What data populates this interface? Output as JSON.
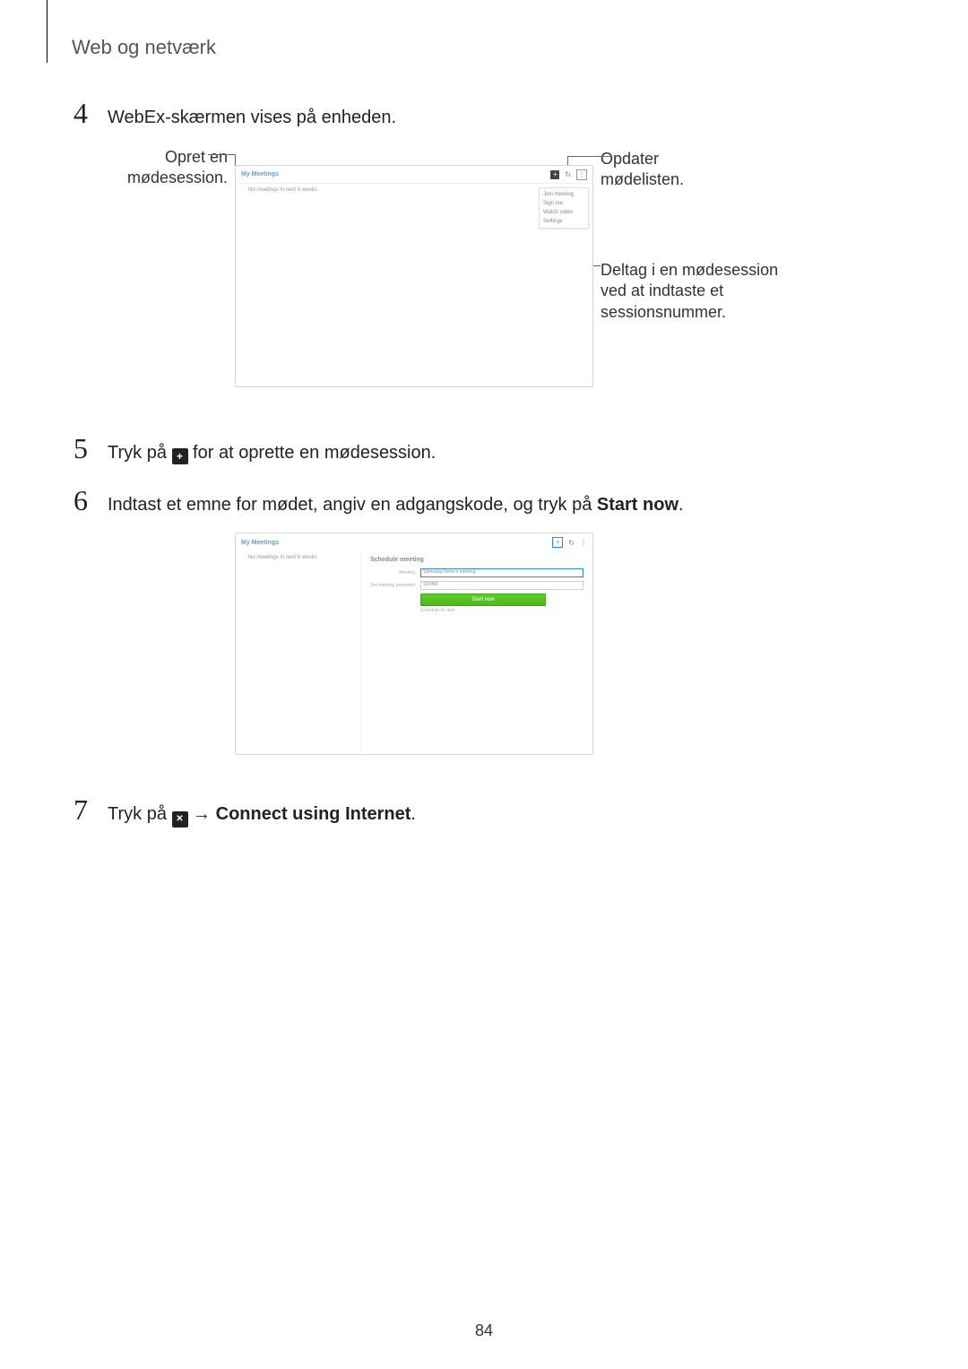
{
  "section_title": "Web og netværk",
  "steps": {
    "s4": {
      "num": "4",
      "text": "WebEx-skærmen vises på enheden."
    },
    "s5": {
      "num": "5",
      "pre": "Tryk på ",
      "post": " for at oprette en mødesession.",
      "icon_symbol": "+",
      "icon_name": "plus"
    },
    "s6": {
      "num": "6",
      "pre": "Indtast et emne for mødet, angiv en adgangskode, og tryk på ",
      "bold": "Start now",
      "post": "."
    },
    "s7": {
      "num": "7",
      "pre": "Tryk på ",
      "arrow": " → ",
      "bold": "Connect using Internet",
      "post": ".",
      "icon_symbol": "✕",
      "icon_name": "signal"
    }
  },
  "annotations": {
    "opret": "Opret en mødesession.",
    "opdater": "Opdater mødelisten.",
    "deltag": "Deltag i en mødesession ved at indtaste et sessionsnummer."
  },
  "shot1": {
    "title": "My Meetings",
    "empty_text": "No meetings in next 6 weeks",
    "dropdown": [
      "Join meeting",
      "Sign me",
      "Watch video",
      "Settings"
    ]
  },
  "shot2": {
    "title": "My Meetings",
    "empty_text": "No meetings in next 6 weeks",
    "panel_heading": "Schedule meeting",
    "meeting_label": "Meeting",
    "meeting_value": "Samsung Demo's meeting",
    "password_label": "Set meeting password",
    "password_value": "123456",
    "start_button": "Start now",
    "schedule_later": "Schedule for later"
  },
  "page_number": "84"
}
